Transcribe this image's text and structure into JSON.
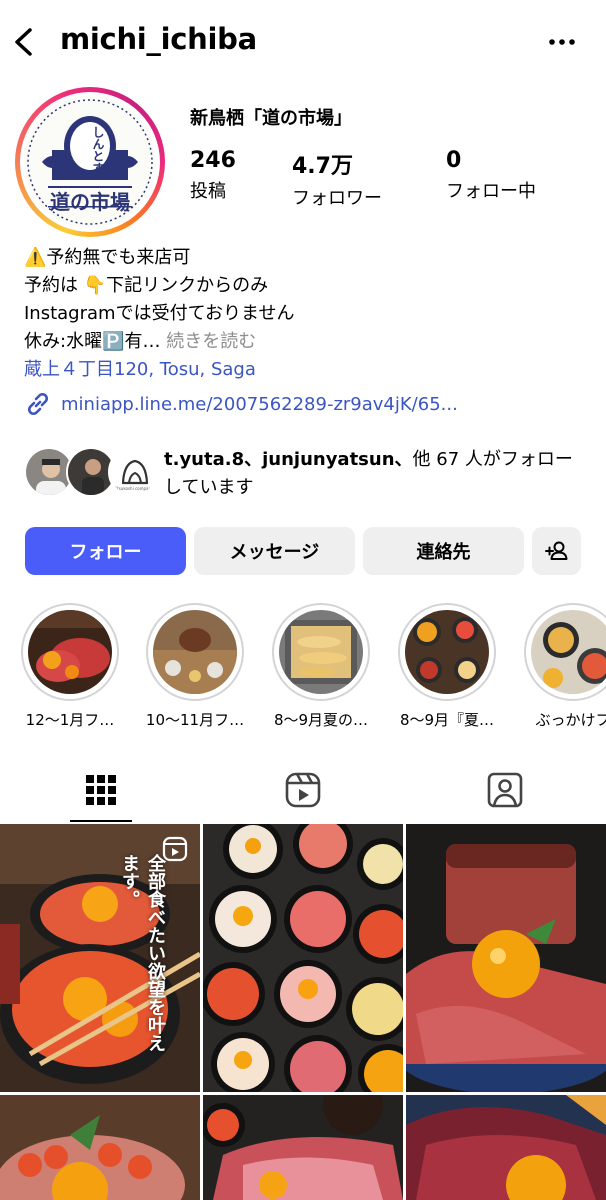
{
  "header": {
    "username": "michi_ichiba"
  },
  "profile": {
    "display_name": "新鳥栖「道の市場」",
    "avatar_text_top": "しんとす",
    "avatar_text_main": "道の市場",
    "stats": [
      {
        "value": "246",
        "label": "投稿"
      },
      {
        "value": "4.7万",
        "label": "フォロワー"
      },
      {
        "value": "0",
        "label": "フォロー中"
      }
    ]
  },
  "bio": {
    "line1_icon": "⚠️",
    "line1": "予約無でも来店可",
    "line2_pre": "予約は",
    "line2_icon": "👇",
    "line2_post": "下記リンクからのみ",
    "line3": "Instagramでは受付ておりません",
    "line4_pre": "休み:水曜",
    "line4_icon": "🅿️",
    "line4_post": "有…",
    "more": "続きを読む",
    "address": "蔵上４丁目120, Tosu, Saga",
    "link": "miniapp.line.me/2007562289-zr9av4jK/65..."
  },
  "followed_by": {
    "names": "t.yuta.8、junjunyatsun、",
    "rest": "他 67 人がフォローしています",
    "logo_caption": "Mitsukoshi company"
  },
  "buttons": {
    "follow": "フォロー",
    "message": "メッセージ",
    "contact": "連絡先"
  },
  "highlights": [
    {
      "label": "12～1月フ…"
    },
    {
      "label": "10～11月フ…"
    },
    {
      "label": "8～9月夏の…"
    },
    {
      "label": "8～9月『夏…"
    },
    {
      "label": "ぶっかけフ"
    }
  ],
  "tabs": [
    {
      "name": "grid",
      "icon": "grid-icon",
      "active": true
    },
    {
      "name": "reels",
      "icon": "reels-icon",
      "active": false
    },
    {
      "name": "tagged",
      "icon": "tagged-icon",
      "active": false
    }
  ],
  "posts": {
    "first_overlay_a": "全部食べたい",
    "first_overlay_b": "欲望を叶えます。"
  },
  "colors": {
    "follow_button": "#4a5df9",
    "link": "#3b55c2",
    "button_gray": "#efeff0"
  }
}
